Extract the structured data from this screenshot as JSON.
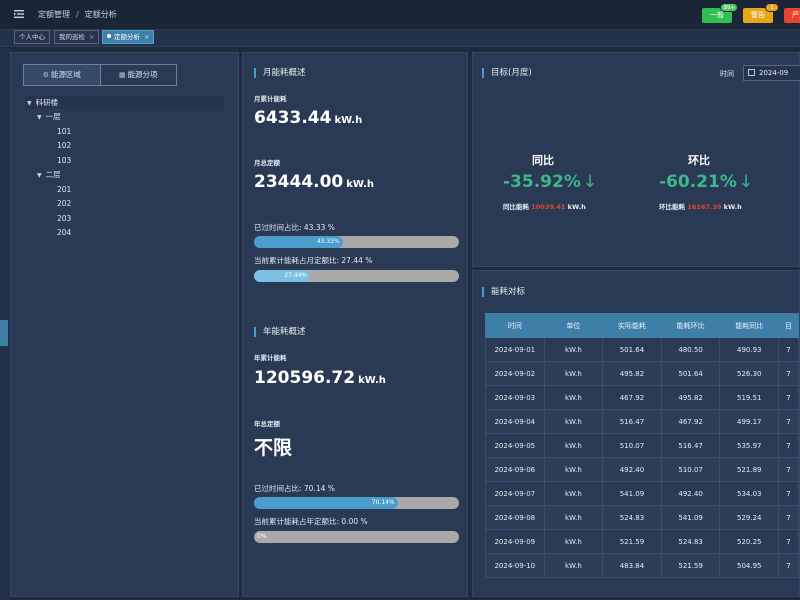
{
  "header": {
    "breadcrumb": [
      "定额管理",
      "定额分析"
    ],
    "buttons": [
      {
        "label": "一般",
        "badge": "99+",
        "color": "#2fbf52"
      },
      {
        "label": "警告",
        "badge": "1",
        "color": "#e7a71a"
      },
      {
        "label": "严重",
        "color": "#e8442d"
      }
    ]
  },
  "tabs": [
    {
      "label": "个人中心"
    },
    {
      "label": "我的巡检",
      "close": "×"
    },
    {
      "label": "定额分析",
      "close": "×",
      "active": true
    }
  ],
  "tree_panel": {
    "tabs": [
      {
        "label": "能源区域",
        "icon": "⚙"
      },
      {
        "label": "能源分项",
        "icon": "▦"
      }
    ],
    "root": "科研楼",
    "groups": [
      {
        "label": "一层",
        "children": [
          "101",
          "102",
          "103"
        ]
      },
      {
        "label": "二层",
        "children": [
          "201",
          "202",
          "203",
          "204"
        ]
      }
    ]
  },
  "monthly": {
    "title": "月能耗概述",
    "cum_label": "月累计能耗",
    "cum_value": "6433.44",
    "unit": "kW.h",
    "quota_label": "月总定额",
    "quota_value": "23444.00",
    "time_pct_text": "已过时间占比:  43.33 %",
    "time_pct": 43.33,
    "time_pct_bar": "43.33%",
    "usage_pct_text": "当前累计能耗占月定额比:  27.44 %",
    "usage_pct": 27.44,
    "usage_pct_bar": "27.44%"
  },
  "yearly": {
    "title": "年能耗概述",
    "cum_label": "年累计能耗",
    "cum_value": "120596.72",
    "unit": "kW.h",
    "quota_label": "年总定额",
    "quota_value": "不限",
    "time_pct_text": "已过时间占比:  70.14 %",
    "time_pct": 70.14,
    "time_pct_bar": "70.14%",
    "usage_pct_text": "当前累计能耗占年定额比:  0.00 %",
    "usage_pct": 0,
    "usage_pct_bar": "0%"
  },
  "target": {
    "title": "目标(月度)",
    "time_label": "时间",
    "date_value": "2024-09",
    "yoy": {
      "label": "同比",
      "value": "-35.92%",
      "arrow": "↓",
      "sub_label": "同比能耗",
      "sub_value": "10039.41",
      "unit": "kW.h"
    },
    "mom": {
      "label": "环比",
      "value": "-60.21%",
      "arrow": "↓",
      "sub_label": "环比能耗",
      "sub_value": "16167.39",
      "unit": "kW.h"
    }
  },
  "table": {
    "title": "能耗对标",
    "headers": [
      "时间",
      "单位",
      "实际能耗",
      "能耗环比",
      "能耗同比",
      "目"
    ],
    "rows": [
      [
        "2024-09-01",
        "kW.h",
        "501.64",
        "480.50",
        "490.93",
        "7"
      ],
      [
        "2024-09-02",
        "kW.h",
        "495.82",
        "501.64",
        "526.30",
        "7"
      ],
      [
        "2024-09-03",
        "kW.h",
        "467.92",
        "495.82",
        "519.51",
        "7"
      ],
      [
        "2024-09-04",
        "kW.h",
        "516.47",
        "467.92",
        "499.17",
        "7"
      ],
      [
        "2024-09-05",
        "kW.h",
        "510.07",
        "516.47",
        "535.97",
        "7"
      ],
      [
        "2024-09-06",
        "kW.h",
        "492.40",
        "510.07",
        "521.89",
        "7"
      ],
      [
        "2024-09-07",
        "kW.h",
        "541.09",
        "492.40",
        "534.03",
        "7"
      ],
      [
        "2024-09-08",
        "kW.h",
        "524.83",
        "541.09",
        "529.24",
        "7"
      ],
      [
        "2024-09-09",
        "kW.h",
        "521.59",
        "524.83",
        "520.25",
        "7"
      ],
      [
        "2024-09-10",
        "kW.h",
        "483.84",
        "521.59",
        "504.95",
        "7"
      ]
    ]
  }
}
